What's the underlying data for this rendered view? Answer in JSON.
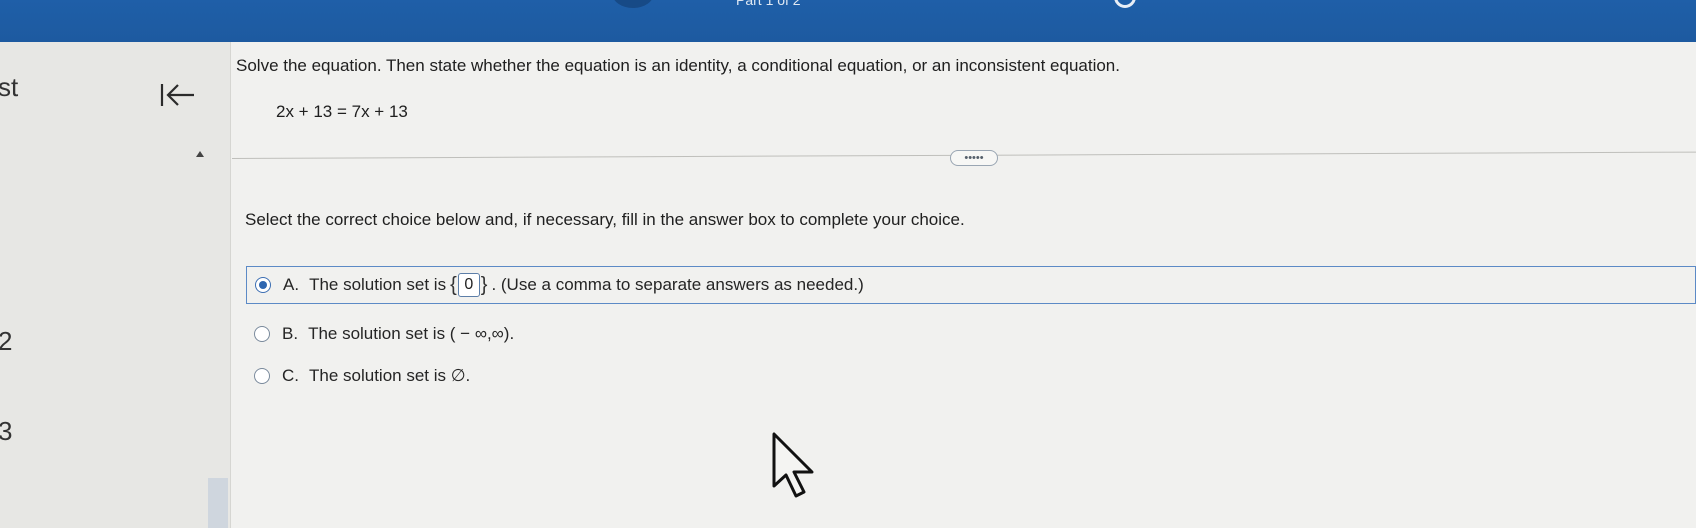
{
  "header": {
    "caption": "Part 1 of 2"
  },
  "sidebar": {
    "numbers": [
      "st",
      "2",
      "3"
    ]
  },
  "question": {
    "prompt": "Solve the equation. Then state whether the equation is an identity, a conditional equation, or an inconsistent equation.",
    "equation": "2x + 13 = 7x + 13",
    "more_label": "•••••",
    "instruction": "Select the correct choice below and, if necessary, fill in the answer box to complete your choice."
  },
  "choices": {
    "a": {
      "letter": "A.",
      "text_before": "The solution set is",
      "brace_open": "{",
      "answer_value": "0",
      "brace_close": "}",
      "text_after": ". (Use a comma to separate answers as needed.)",
      "selected": true
    },
    "b": {
      "letter": "B.",
      "text": "The solution set is ( − ∞,∞).",
      "selected": false
    },
    "c": {
      "letter": "C.",
      "text": "The solution set is ∅.",
      "selected": false
    }
  },
  "colors": {
    "header_blue": "#1f5fa8",
    "selection_border": "#5c8ac6",
    "radio_fill": "#2e66b0"
  },
  "icons": {
    "collapse": "collapse-left-icon",
    "scroll_up": "caret-up-icon",
    "cursor": "mouse-pointer-icon"
  }
}
